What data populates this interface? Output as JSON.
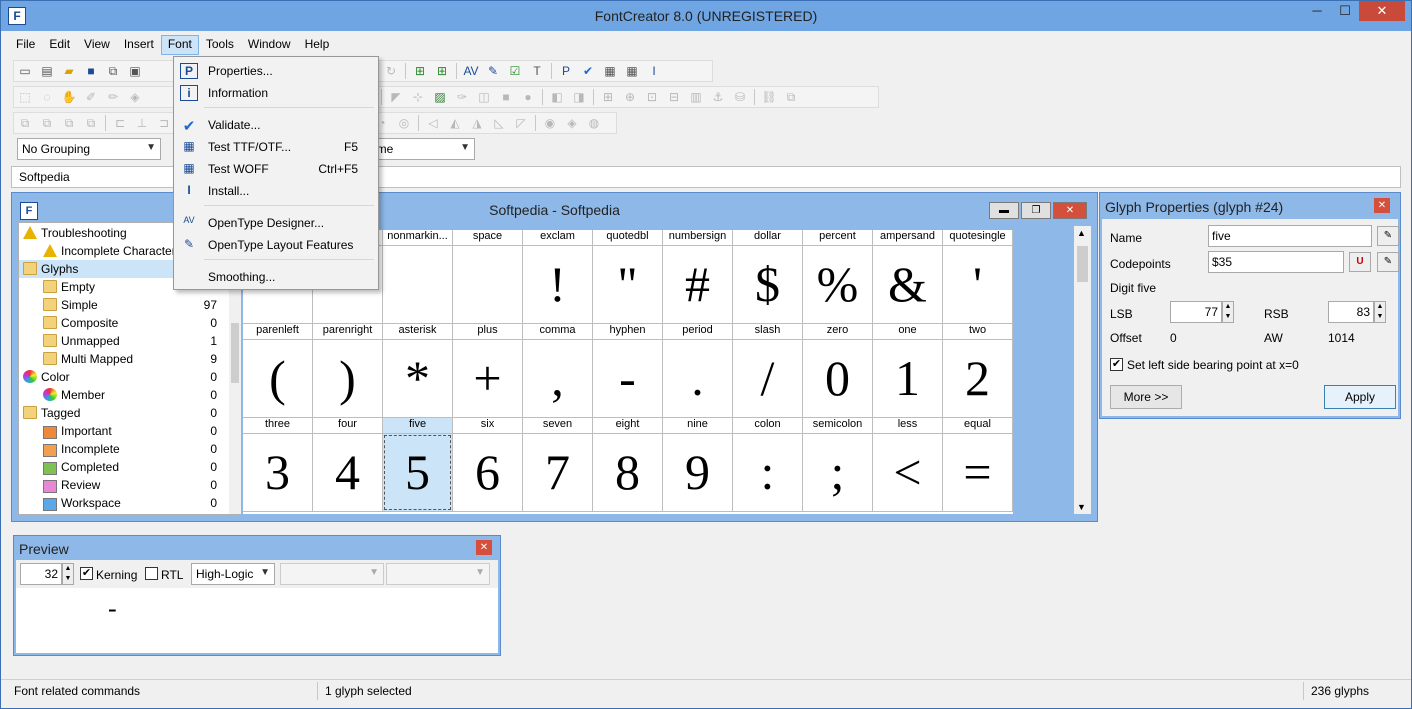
{
  "window": {
    "title": "FontCreator 8.0 (UNREGISTERED)",
    "app_icon": "F"
  },
  "window_controls": {
    "minimize": "─",
    "maximize": "☐",
    "close": "✕"
  },
  "menubar": [
    {
      "label": "File"
    },
    {
      "label": "Edit"
    },
    {
      "label": "View"
    },
    {
      "label": "Insert"
    },
    {
      "label": "Font"
    },
    {
      "label": "Tools"
    },
    {
      "label": "Window"
    },
    {
      "label": "Help"
    }
  ],
  "font_menu": [
    {
      "label": "Properties...",
      "shortcut": "",
      "icon": "properties-icon",
      "glyph": "P"
    },
    {
      "label": "Information",
      "shortcut": "",
      "icon": "information-icon",
      "glyph": "i"
    },
    {
      "label": "Validate...",
      "shortcut": "",
      "icon": "validate-check-icon",
      "glyph": "✔"
    },
    {
      "label": "Test TTF/OTF...",
      "shortcut": "F5",
      "icon": "test-ttf-icon",
      "glyph": "▦"
    },
    {
      "label": "Test WOFF",
      "shortcut": "Ctrl+F5",
      "icon": "test-woff-icon",
      "glyph": "▦"
    },
    {
      "label": "Install...",
      "shortcut": "",
      "icon": "install-icon",
      "glyph": "I"
    },
    {
      "label": "OpenType Designer...",
      "shortcut": "",
      "icon": "opentype-designer-icon",
      "glyph": "AV"
    },
    {
      "label": "OpenType Layout Features",
      "shortcut": "",
      "icon": "opentype-layout-icon",
      "glyph": "✎"
    },
    {
      "label": "Smoothing...",
      "shortcut": "",
      "icon": "smoothing-icon",
      "glyph": ""
    }
  ],
  "toolbar": {
    "grouping_select": "No Grouping",
    "sort_select": "ame",
    "font_select": "Softpedia"
  },
  "glyph_window": {
    "title": "Softpedia - Softpedia",
    "icon": "F",
    "buttons": {
      "minimize": "▬",
      "restore": "❐",
      "close": "✕"
    }
  },
  "tree": [
    {
      "label": "Troubleshooting",
      "count": "",
      "icon": "warning-icon",
      "indent": 0,
      "kind": "warn"
    },
    {
      "label": "Incomplete Characters",
      "count": "",
      "icon": "warning-icon",
      "indent": 1,
      "kind": "warn"
    },
    {
      "label": "Glyphs",
      "count": "",
      "icon": "folder-icon",
      "indent": 0,
      "kind": "folder",
      "selected": true
    },
    {
      "label": "Empty",
      "count": "",
      "icon": "folder-icon",
      "indent": 1,
      "kind": "folder"
    },
    {
      "label": "Simple",
      "count": "97",
      "icon": "folder-icon",
      "indent": 1,
      "kind": "folder"
    },
    {
      "label": "Composite",
      "count": "0",
      "icon": "folder-icon",
      "indent": 1,
      "kind": "folder"
    },
    {
      "label": "Unmapped",
      "count": "1",
      "icon": "folder-icon",
      "indent": 1,
      "kind": "folder"
    },
    {
      "label": "Multi Mapped",
      "count": "9",
      "icon": "folder-icon",
      "indent": 1,
      "kind": "folder"
    },
    {
      "label": "Color",
      "count": "0",
      "icon": "color-wheel-icon",
      "indent": 0,
      "kind": "color"
    },
    {
      "label": "Member",
      "count": "0",
      "icon": "color-wheel-icon",
      "indent": 1,
      "kind": "color"
    },
    {
      "label": "Tagged",
      "count": "0",
      "icon": "folder-icon",
      "indent": 0,
      "kind": "folder"
    },
    {
      "label": "Important",
      "count": "0",
      "icon": "flag-orange-icon",
      "indent": 1,
      "kind": "flag",
      "color": "#f0883a"
    },
    {
      "label": "Incomplete",
      "count": "0",
      "icon": "flag-orange-icon",
      "indent": 1,
      "kind": "flag",
      "color": "#f0a050"
    },
    {
      "label": "Completed",
      "count": "0",
      "icon": "flag-green-icon",
      "indent": 1,
      "kind": "flag",
      "color": "#7dc253"
    },
    {
      "label": "Review",
      "count": "0",
      "icon": "flag-pink-icon",
      "indent": 1,
      "kind": "flag",
      "color": "#e787d6"
    },
    {
      "label": "Workspace",
      "count": "0",
      "icon": "flag-blue-icon",
      "indent": 1,
      "kind": "flag",
      "color": "#5aa8e8"
    }
  ],
  "glyph_rows": [
    [
      {
        "name": "",
        "char": "·"
      },
      {
        "name": "",
        "char": ""
      },
      {
        "name": "nonmarkin...",
        "char": ""
      },
      {
        "name": "space",
        "char": ""
      },
      {
        "name": "exclam",
        "char": "!"
      },
      {
        "name": "quotedbl",
        "char": "\""
      },
      {
        "name": "numbersign",
        "char": "#"
      },
      {
        "name": "dollar",
        "char": "$"
      },
      {
        "name": "percent",
        "char": "%"
      },
      {
        "name": "ampersand",
        "char": "&"
      },
      {
        "name": "quotesingle",
        "char": "'"
      }
    ],
    [
      {
        "name": "parenleft",
        "char": "("
      },
      {
        "name": "parenright",
        "char": ")"
      },
      {
        "name": "asterisk",
        "char": "*"
      },
      {
        "name": "plus",
        "char": "+"
      },
      {
        "name": "comma",
        "char": ","
      },
      {
        "name": "hyphen",
        "char": "-"
      },
      {
        "name": "period",
        "char": "."
      },
      {
        "name": "slash",
        "char": "/"
      },
      {
        "name": "zero",
        "char": "0"
      },
      {
        "name": "one",
        "char": "1"
      },
      {
        "name": "two",
        "char": "2"
      }
    ],
    [
      {
        "name": "three",
        "char": "3"
      },
      {
        "name": "four",
        "char": "4"
      },
      {
        "name": "five",
        "char": "5",
        "selected": true
      },
      {
        "name": "six",
        "char": "6"
      },
      {
        "name": "seven",
        "char": "7"
      },
      {
        "name": "eight",
        "char": "8"
      },
      {
        "name": "nine",
        "char": "9"
      },
      {
        "name": "colon",
        "char": ":"
      },
      {
        "name": "semicolon",
        "char": ";"
      },
      {
        "name": "less",
        "char": "<"
      },
      {
        "name": "equal",
        "char": "="
      }
    ]
  ],
  "glyph_properties": {
    "title": "Glyph Properties (glyph #24)",
    "name_label": "Name",
    "name_value": "five",
    "codepoints_label": "Codepoints",
    "codepoints_value": "$35",
    "description": "Digit five",
    "lsb_label": "LSB",
    "lsb_value": "77",
    "rsb_label": "RSB",
    "rsb_value": "83",
    "offset_label": "Offset",
    "offset_value": "0",
    "aw_label": "AW",
    "aw_value": "1014",
    "checkbox_label": "Set left side bearing point at x=0",
    "checkbox_checked": "✔",
    "more_button": "More >>",
    "apply_button": "Apply",
    "close": "✕"
  },
  "preview": {
    "title": "Preview",
    "size_value": "32",
    "kerning_label": "Kerning",
    "kerning_checked": "✔",
    "rtl_label": "RTL",
    "render_select": "High-Logic",
    "preview_text": "-",
    "close": "✕"
  },
  "status": {
    "left": "Font related commands",
    "middle": "1 glyph selected",
    "right": "236 glyphs"
  },
  "colors": {
    "titlebar": "#6fa5e2",
    "selection": "#cce4f7",
    "close_red": "#c94a3a"
  }
}
